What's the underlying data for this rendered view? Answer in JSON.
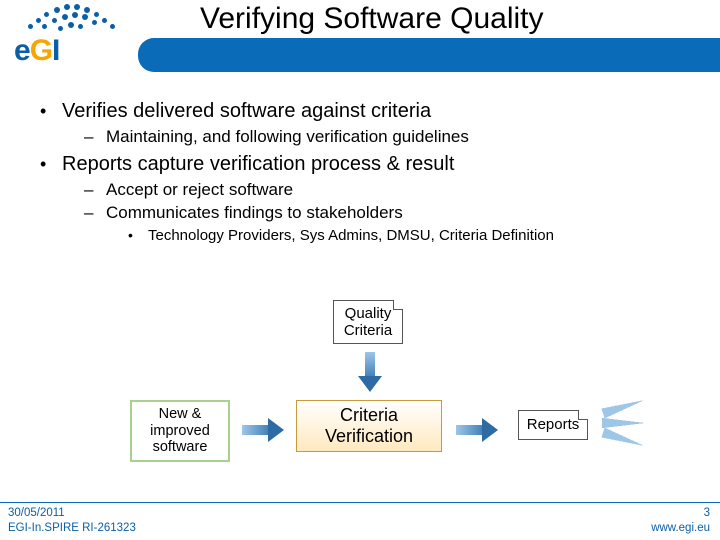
{
  "logo_text_parts": {
    "e": "e",
    "g": "G",
    "i": "I"
  },
  "slide_title": "Verifying Software Quality",
  "bullets": {
    "b1": "Verifies delivered software against criteria",
    "b1_1": "Maintaining, and following verification guidelines",
    "b2": "Reports capture verification process & result",
    "b2_1": "Accept or reject software",
    "b2_2": "Communicates findings to stakeholders",
    "b2_2_1": "Technology Providers, Sys Admins, DMSU, Criteria Definition"
  },
  "diagram": {
    "quality_criteria": "Quality\nCriteria",
    "new_software": "New &\nimproved\nsoftware",
    "criteria_verification": "Criteria\nVerification",
    "reports": "Reports"
  },
  "footer": {
    "date": "30/05/2011",
    "project": "EGI-In.SPIRE RI-261323",
    "page": "3",
    "url": "www.egi.eu"
  }
}
